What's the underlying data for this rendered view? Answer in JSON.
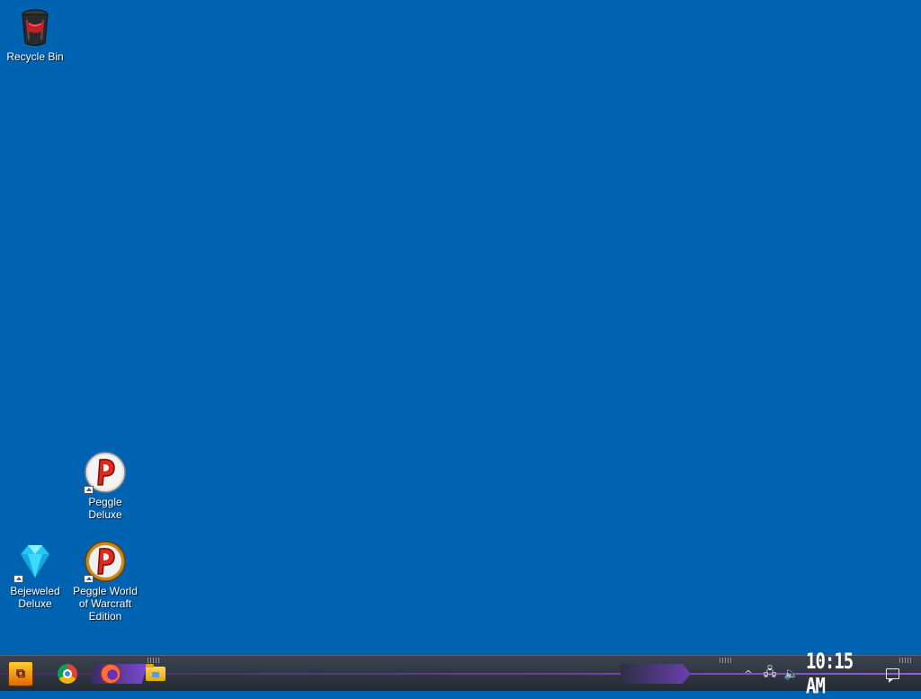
{
  "desktop": {
    "background_color": "#0063b1",
    "icons": [
      {
        "label": "Recycle Bin",
        "icon": "recycle-bin-icon",
        "shortcut": false
      },
      {
        "label": "Peggle Deluxe",
        "icon": "peggle-icon",
        "shortcut": true
      },
      {
        "label": "Bejeweled Deluxe",
        "icon": "diamond-icon",
        "shortcut": true
      },
      {
        "label": "Peggle World of Warcraft Edition",
        "icon": "peggle-icon",
        "shortcut": true
      }
    ]
  },
  "taskbar": {
    "pinned": [
      {
        "name": "Start",
        "icon": "start-icon",
        "glyph": "⧉"
      },
      {
        "name": "Google Chrome",
        "icon": "chrome-icon"
      },
      {
        "name": "Firefox",
        "icon": "firefox-icon"
      },
      {
        "name": "File Explorer",
        "icon": "folder-icon"
      }
    ],
    "tray": {
      "show_hidden_glyph": "^",
      "network_glyph": "🖧",
      "volume_glyph": "🔈"
    },
    "clock": "10:15 AM",
    "accent_color": "#7b4bcf"
  }
}
